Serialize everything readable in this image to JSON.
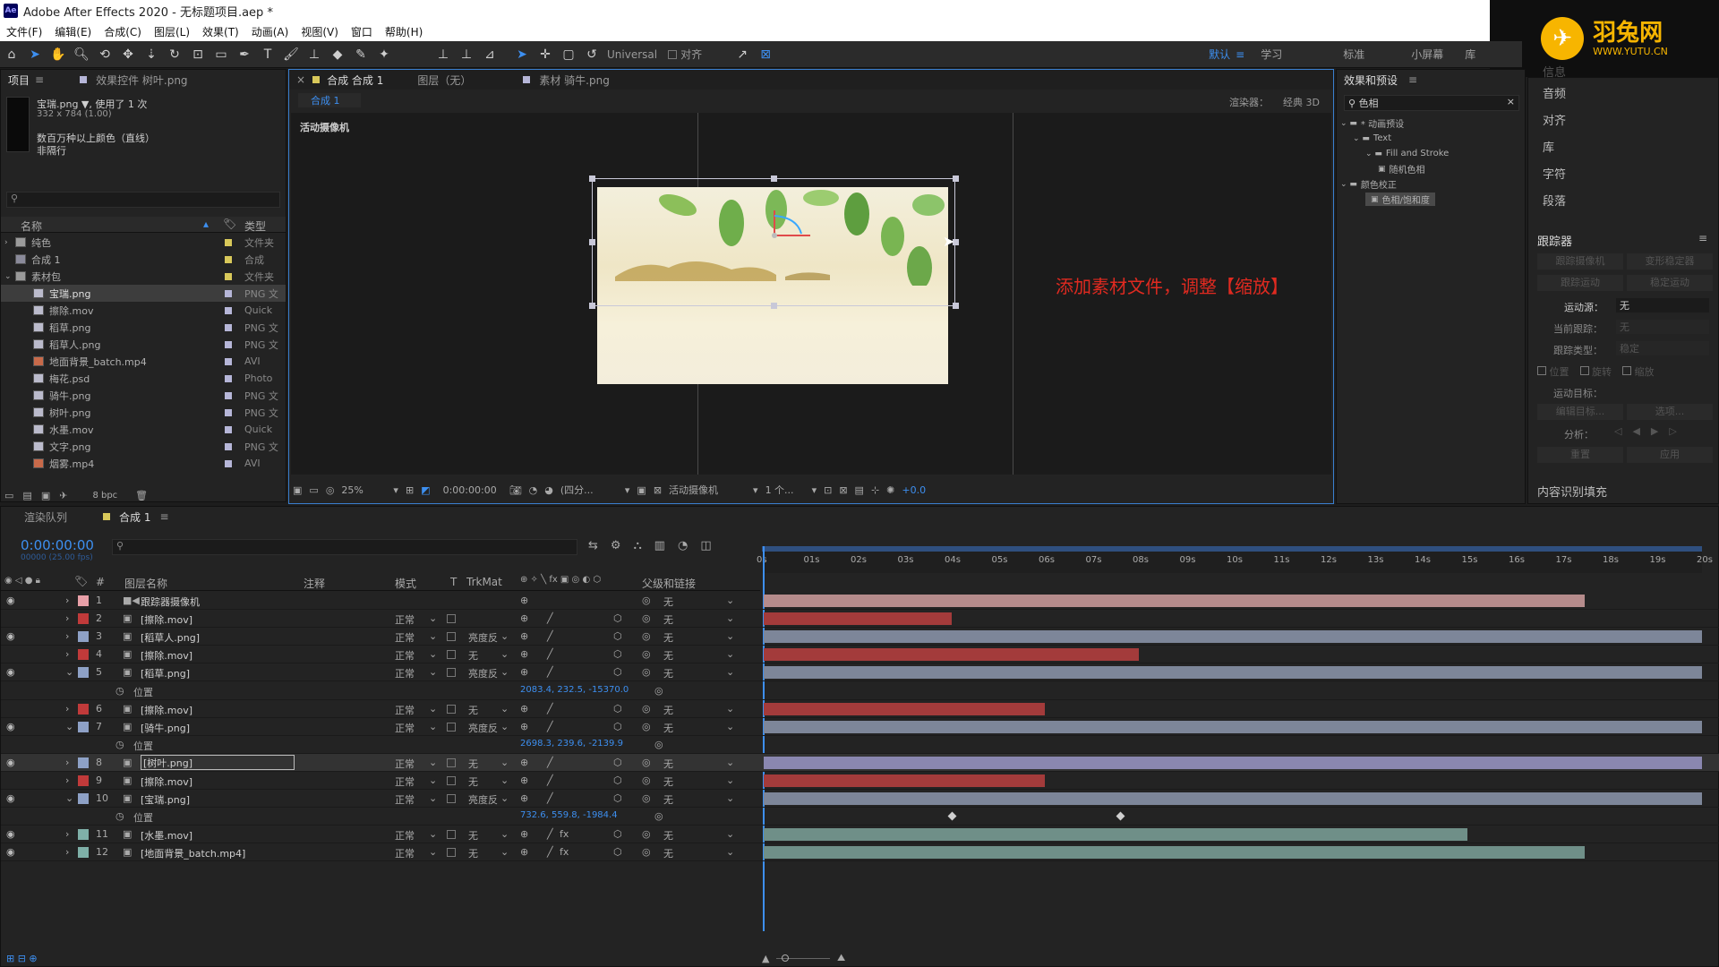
{
  "app": {
    "title": "Adobe After Effects 2020 - 无标题项目.aep *",
    "icon_text": "Ae"
  },
  "menu": [
    "文件(F)",
    "编辑(E)",
    "合成(C)",
    "图层(L)",
    "效果(T)",
    "动画(A)",
    "视图(V)",
    "窗口",
    "帮助(H)"
  ],
  "toolbar": {
    "universal": "Universal",
    "align": "对齐"
  },
  "workspaces": [
    "默认",
    "学习",
    "标准",
    "小屏幕",
    "库"
  ],
  "logo": {
    "name": "羽兔网",
    "url": "WWW.YUTU.CN"
  },
  "project": {
    "tabs": [
      "项目",
      "效果控件 树叶.png"
    ],
    "asset_name": "宝瑞.png ▼, 使用了 1 次",
    "asset_dims": "332 x 784 (1.00)",
    "asset_color": "数百万种以上颜色（直线）",
    "asset_extra": "非隔行",
    "col_name": "名称",
    "col_type": "类型",
    "items": [
      {
        "name": "纯色",
        "type": "文件夹",
        "color": "#d8c85a",
        "indent": 0,
        "kind": "folder"
      },
      {
        "name": "合成 1",
        "type": "合成",
        "color": "#d8c85a",
        "indent": 0,
        "kind": "comp"
      },
      {
        "name": "素材包",
        "type": "文件夹",
        "color": "#d8c85a",
        "indent": 0,
        "kind": "folder"
      },
      {
        "name": "宝瑞.png",
        "type": "PNG 文",
        "color": "#b6b6d8",
        "indent": 1,
        "kind": "png",
        "selected": true
      },
      {
        "name": "擦除.mov",
        "type": "Quick",
        "color": "#b6b6d8",
        "indent": 1,
        "kind": "mov"
      },
      {
        "name": "稻草.png",
        "type": "PNG 文",
        "color": "#b6b6d8",
        "indent": 1,
        "kind": "png"
      },
      {
        "name": "稻草人.png",
        "type": "PNG 文",
        "color": "#b6b6d8",
        "indent": 1,
        "kind": "png"
      },
      {
        "name": "地面背景_batch.mp4",
        "type": "AVI",
        "color": "#b6b6d8",
        "indent": 1,
        "kind": "mp4"
      },
      {
        "name": "梅花.psd",
        "type": "Photo",
        "color": "#b6b6d8",
        "indent": 1,
        "kind": "psd"
      },
      {
        "name": "骑牛.png",
        "type": "PNG 文",
        "color": "#b6b6d8",
        "indent": 1,
        "kind": "png"
      },
      {
        "name": "树叶.png",
        "type": "PNG 文",
        "color": "#b6b6d8",
        "indent": 1,
        "kind": "png"
      },
      {
        "name": "水墨.mov",
        "type": "Quick",
        "color": "#b6b6d8",
        "indent": 1,
        "kind": "mov"
      },
      {
        "name": "文字.png",
        "type": "PNG 文",
        "color": "#b6b6d8",
        "indent": 1,
        "kind": "png"
      },
      {
        "name": "烟雾.mp4",
        "type": "AVI",
        "color": "#b6b6d8",
        "indent": 1,
        "kind": "mp4"
      }
    ],
    "bpc": "8 bpc"
  },
  "viewer": {
    "tabs": [
      "合成 合成 1",
      "图层（无）",
      "素材 骑牛.png"
    ],
    "subtab": "合成 1",
    "renderer": "渲染器：",
    "renderer_mode": "经典 3D",
    "camera_label": "活动摄像机",
    "annotation": "添加素材文件，调整【缩放】",
    "bottom": {
      "zoom": "25%",
      "time": "0:00:00:00",
      "quality": "(四分...",
      "camera": "活动摄像机",
      "views": "1 个...",
      "exposure": "+0.0"
    }
  },
  "effects": {
    "title": "效果和预设",
    "search": "色相",
    "tree": [
      {
        "label": "* 动画预设",
        "indent": 0
      },
      {
        "label": "Text",
        "indent": 1
      },
      {
        "label": "Fill and Stroke",
        "indent": 2
      },
      {
        "label": "随机色相",
        "indent": 3
      },
      {
        "label": "颜色校正",
        "indent": 0
      },
      {
        "label": "色相/饱和度",
        "indent": 2,
        "selected": true
      }
    ]
  },
  "right_panels": [
    "信息",
    "音频",
    "对齐",
    "库",
    "字符",
    "段落"
  ],
  "tracker": {
    "title": "跟踪器",
    "btn1": "跟踪摄像机",
    "btn2": "变形稳定器",
    "btn3": "跟踪运动",
    "btn4": "稳定运动",
    "source_label": "运动源：",
    "source_val": "无",
    "current_label": "当前跟踪：",
    "current_val": "无",
    "type_label": "跟踪类型：",
    "type_val": "稳定",
    "checks": [
      "位置",
      "旋转",
      "缩放"
    ],
    "target_label": "运动目标：",
    "edit_target": "编辑目标...",
    "options": "选项...",
    "analyze": "分析：",
    "reset": "重置",
    "apply": "应用"
  },
  "content_fill": "内容识别填充",
  "timeline": {
    "tabs": [
      "渲染队列",
      "合成 1"
    ],
    "timecode": "0:00:00:00",
    "fps": "00000 (25.00 fps)",
    "headers": {
      "layer_name": "图层名称",
      "comment": "注释",
      "mode": "模式",
      "t": "T",
      "trkmat": "TrkMat",
      "parent": "父级和链接"
    },
    "ruler": [
      "0s",
      "01s",
      "02s",
      "03s",
      "04s",
      "05s",
      "06s",
      "07s",
      "08s",
      "09s",
      "10s",
      "11s",
      "12s",
      "13s",
      "14s",
      "15s",
      "16s",
      "17s",
      "18s",
      "19s",
      "20s"
    ],
    "duration_s": 20,
    "rows": [
      {
        "num": "1",
        "name": "跟踪器摄像机",
        "kind": "camera",
        "mode": "",
        "trk": "",
        "parent": "无",
        "color": "#e8a0a8",
        "bar": [
          0,
          17.5
        ],
        "bar_color": "#b58b8b",
        "eye": true
      },
      {
        "num": "2",
        "name": "[擦除.mov]",
        "kind": "mov",
        "mode": "正常",
        "trk": "",
        "parent": "无",
        "color": "#c03a3a",
        "bar": [
          0,
          4
        ],
        "bar_color": "#a33b3b",
        "eye": false
      },
      {
        "num": "3",
        "name": "[稻草人.png]",
        "kind": "png",
        "mode": "正常",
        "trk": "亮度反",
        "parent": "无",
        "color": "#8ea1c6",
        "bar": [
          0,
          20
        ],
        "bar_color": "#7d8699",
        "eye": true
      },
      {
        "num": "4",
        "name": "[擦除.mov]",
        "kind": "mov",
        "mode": "正常",
        "trk": "无",
        "parent": "无",
        "color": "#c03a3a",
        "bar": [
          0,
          8
        ],
        "bar_color": "#a33b3b",
        "eye": false
      },
      {
        "num": "5",
        "name": "[稻草.png]",
        "kind": "png",
        "mode": "正常",
        "trk": "亮度反",
        "parent": "无",
        "color": "#8ea1c6",
        "bar": [
          0,
          20
        ],
        "bar_color": "#7d8699",
        "eye": true,
        "expanded": true
      },
      {
        "prop": true,
        "label": "位置",
        "value": "2083.4, 232.5, -15370.0"
      },
      {
        "num": "6",
        "name": "[擦除.mov]",
        "kind": "mov",
        "mode": "正常",
        "trk": "无",
        "parent": "无",
        "color": "#c03a3a",
        "bar": [
          0,
          6
        ],
        "bar_color": "#a33b3b",
        "eye": false
      },
      {
        "num": "7",
        "name": "[骑牛.png]",
        "kind": "png",
        "mode": "正常",
        "trk": "亮度反",
        "parent": "无",
        "color": "#8ea1c6",
        "bar": [
          0,
          20
        ],
        "bar_color": "#7d8699",
        "eye": true,
        "expanded": true
      },
      {
        "prop": true,
        "label": "位置",
        "value": "2698.3, 239.6, -2139.9"
      },
      {
        "num": "8",
        "name": "[树叶.png]",
        "kind": "png",
        "mode": "正常",
        "trk": "无",
        "parent": "无",
        "color": "#8ea1c6",
        "bar": [
          0,
          20
        ],
        "bar_color": "#8a87b0",
        "eye": true,
        "selected": true
      },
      {
        "num": "9",
        "name": "[擦除.mov]",
        "kind": "mov",
        "mode": "正常",
        "trk": "无",
        "parent": "无",
        "color": "#c03a3a",
        "bar": [
          0,
          6
        ],
        "bar_color": "#a33b3b",
        "eye": false
      },
      {
        "num": "10",
        "name": "[宝瑞.png]",
        "kind": "png",
        "mode": "正常",
        "trk": "亮度反",
        "parent": "无",
        "color": "#8ea1c6",
        "bar": [
          0,
          20
        ],
        "bar_color": "#7d8699",
        "eye": true,
        "expanded": true
      },
      {
        "prop": true,
        "label": "位置",
        "value": "732.6, 559.8, -1984.4",
        "keys": [
          4,
          7.6
        ]
      },
      {
        "num": "11",
        "name": "[水墨.mov]",
        "kind": "mov",
        "mode": "正常",
        "trk": "无",
        "parent": "无",
        "color": "#7fb0a8",
        "bar": [
          0,
          15
        ],
        "bar_color": "#6f8f88",
        "eye": true,
        "fx": true
      },
      {
        "num": "12",
        "name": "[地面背景_batch.mp4]",
        "kind": "mp4",
        "mode": "正常",
        "trk": "无",
        "parent": "无",
        "color": "#7fb0a8",
        "bar": [
          0,
          17.5
        ],
        "bar_color": "#6f8f88",
        "eye": true,
        "fx": true
      }
    ]
  }
}
